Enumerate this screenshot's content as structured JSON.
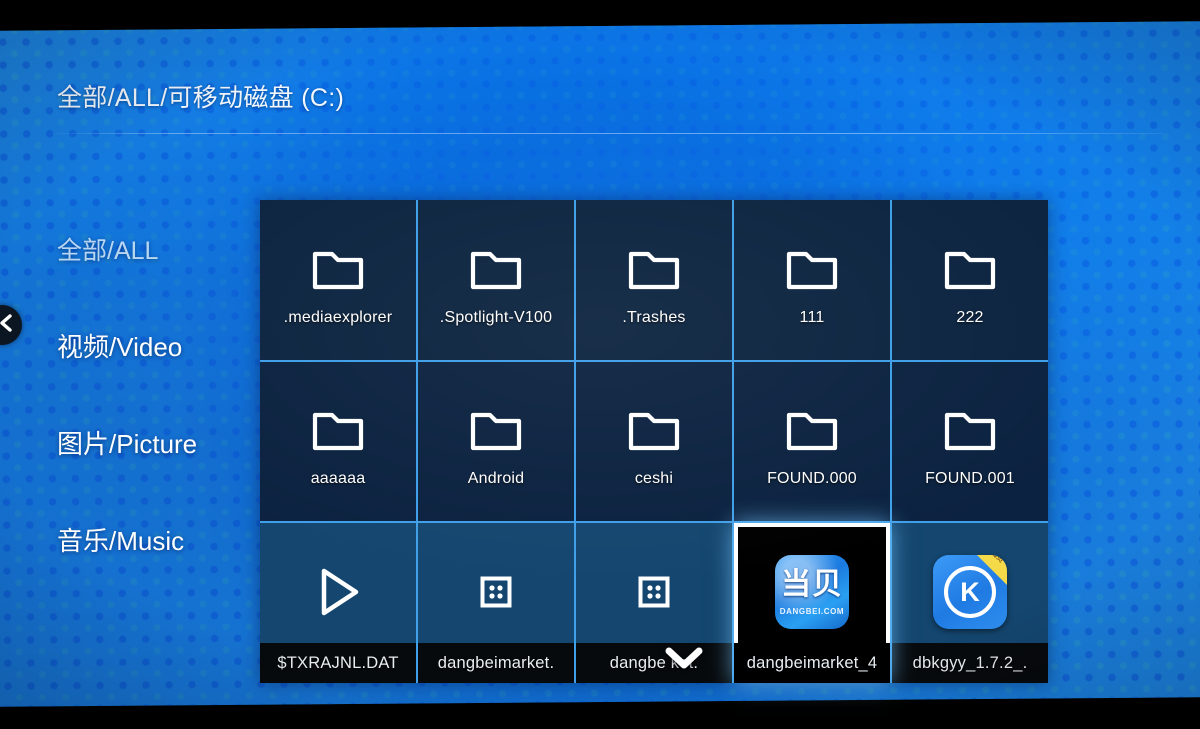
{
  "header": {
    "breadcrumb": "全部/ALL/可移动磁盘 (C:)"
  },
  "back_handle": {
    "icon": "chevron-left-icon"
  },
  "sidebar": {
    "items": [
      {
        "label": "全部/ALL",
        "active": true
      },
      {
        "label": "视频/Video",
        "active": false
      },
      {
        "label": "图片/Picture",
        "active": false
      },
      {
        "label": "音乐/Music",
        "active": false
      }
    ]
  },
  "grid": {
    "columns": 5,
    "rows": 3,
    "items": [
      {
        "label": ".mediaexplorer",
        "icon": "folder-icon",
        "row": 1,
        "selected": false
      },
      {
        "label": ".Spotlight-V100",
        "icon": "folder-icon",
        "row": 1,
        "selected": false
      },
      {
        "label": ".Trashes",
        "icon": "folder-icon",
        "row": 1,
        "selected": false
      },
      {
        "label": "111",
        "icon": "folder-icon",
        "row": 1,
        "selected": false
      },
      {
        "label": "222",
        "icon": "folder-icon",
        "row": 1,
        "selected": false
      },
      {
        "label": "aaaaaa",
        "icon": "folder-icon",
        "row": 2,
        "selected": false
      },
      {
        "label": "Android",
        "icon": "folder-icon",
        "row": 2,
        "selected": false
      },
      {
        "label": "ceshi",
        "icon": "folder-icon",
        "row": 2,
        "selected": false
      },
      {
        "label": "FOUND.000",
        "icon": "folder-icon",
        "row": 2,
        "selected": false
      },
      {
        "label": "FOUND.001",
        "icon": "folder-icon",
        "row": 2,
        "selected": false
      },
      {
        "label": "$TXRAJNL.DAT",
        "icon": "play-icon",
        "row": 3,
        "selected": false
      },
      {
        "label": "dangbeimarket.",
        "icon": "apk-file-icon",
        "row": 3,
        "selected": false
      },
      {
        "label": "dangbe     ket.",
        "icon": "apk-file-icon",
        "row": 3,
        "selected": false
      },
      {
        "label": "dangbeimarket_4",
        "icon": "dangbei-app-icon",
        "row": 3,
        "selected": true
      },
      {
        "label": "dbkgyy_1.7.2_.",
        "icon": "kuyun-app-icon",
        "row": 3,
        "selected": false
      }
    ]
  },
  "app_icons": {
    "dangbei": {
      "title": "当贝",
      "url": "DANGBEI.COM"
    },
    "kuyun": {
      "letter": "K",
      "ribbon": "当贝"
    }
  },
  "scroll_hint": {
    "icon": "chevron-down-icon"
  },
  "colors": {
    "wallpaper_blue": "#1b86e4",
    "grid_line": "#3f9fe8",
    "cell_dark": "#0b2038",
    "cell_row3": "#14466f",
    "selection": "#ffffff",
    "label_bar": "#070a0d",
    "accent_yellow": "#f4d949"
  }
}
